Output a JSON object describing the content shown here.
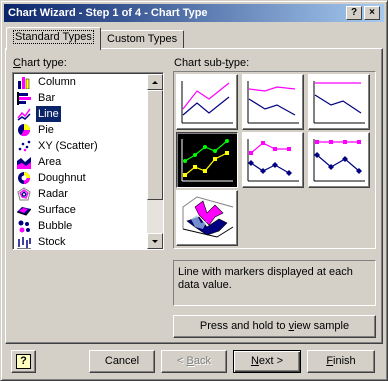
{
  "window": {
    "title": "Chart Wizard - Step 1 of 4 - Chart Type",
    "help_glyph": "?",
    "close_glyph": "×"
  },
  "tabs": [
    {
      "label": "Standard Types",
      "active": true
    },
    {
      "label": "Custom Types",
      "active": false
    }
  ],
  "chart_type": {
    "label_prefix": "",
    "label_accel": "C",
    "label_rest": "hart type:",
    "items": [
      {
        "label": "Column",
        "icon": "column-chart-icon"
      },
      {
        "label": "Bar",
        "icon": "bar-chart-icon"
      },
      {
        "label": "Line",
        "icon": "line-chart-icon",
        "selected": true
      },
      {
        "label": "Pie",
        "icon": "pie-chart-icon"
      },
      {
        "label": "XY (Scatter)",
        "icon": "scatter-chart-icon"
      },
      {
        "label": "Area",
        "icon": "area-chart-icon"
      },
      {
        "label": "Doughnut",
        "icon": "doughnut-chart-icon"
      },
      {
        "label": "Radar",
        "icon": "radar-chart-icon"
      },
      {
        "label": "Surface",
        "icon": "surface-chart-icon"
      },
      {
        "label": "Bubble",
        "icon": "bubble-chart-icon"
      },
      {
        "label": "Stock",
        "icon": "stock-chart-icon"
      }
    ]
  },
  "sub_type": {
    "label_prefix": "Chart sub-",
    "label_accel": "t",
    "label_rest": "ype:",
    "selected_index": 3,
    "description": "Line with markers displayed at each data value."
  },
  "preview_button": {
    "prefix": "Press and hold to ",
    "accel": "v",
    "rest": "iew sample"
  },
  "footer": {
    "help_glyph": "?",
    "cancel": "Cancel",
    "back": "< Back",
    "back_accel_prefix": "< ",
    "back_accel": "B",
    "back_rest": "ack",
    "next_accel": "N",
    "next_rest": "ext >",
    "finish_accel": "F",
    "finish_rest": "inish"
  },
  "colors": {
    "title_start": "#0a246a",
    "title_end": "#a6caf0",
    "face": "#d4d0c8",
    "selection": "#0a246a",
    "series_pink": "#ff00ff",
    "series_navy": "#000080",
    "series_yellow": "#ffff00",
    "series_green": "#00ff00"
  }
}
